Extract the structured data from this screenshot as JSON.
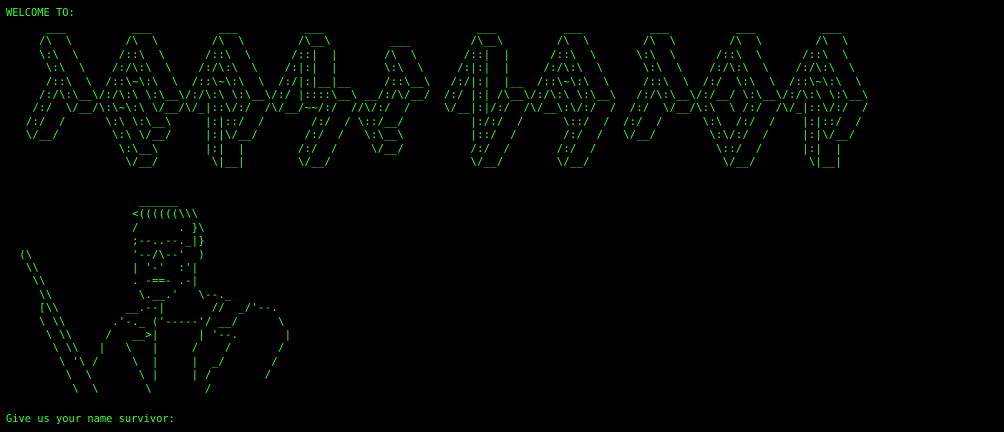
{
  "colors": {
    "background": "#000000",
    "foreground": "#33ff33"
  },
  "terminal": {
    "welcome": "WELCOME TO:",
    "banner_ascii": "      ___          ___          ___          ___                       ___          ___          ___          ___          ___     \n     /\\  \\        /\\  \\        /\\  \\        /\\__\\         ___         /\\__\\        /\\  \\        /\\  \\        /\\  \\        /\\  \\    \n     \\:\\  \\      /::\\  \\      /::\\  \\      /::|  |       /\\  \\       /::|  |      /::\\  \\      \\:\\  \\      /::\\  \\      /::\\  \\   \n      \\:\\  \\    /:/\\:\\  \\    /:/\\:\\  \\    /:|:|  |       \\:\\  \\     /:|:|  |     /:/\\:\\  \\      \\:\\  \\    /:/\\:\\  \\    /:/\\:\\  \\  \n      /::\\  \\  /::\\~\\:\\  \\  /::\\~\\:\\  \\  /:/|:|__|__     /::\\__\\   /:/|:|  |__  /::\\~\\:\\  \\     /::\\  \\  /:/  \\:\\  \\  /::\\~\\:\\  \\ \n     /:/\\:\\__\\/:/\\:\\ \\:\\__\\/:/\\:\\ \\:\\__\\/:/ |::::\\__\\ __/:/\\/__/  /:/ |:| /\\__\\/:/\\:\\ \\:\\__\\   /:/\\:\\__\\/:/__/ \\:\\__\\/:/\\:\\ \\:\\__\\\n    /:/  \\/__/\\:\\~\\:\\ \\/__/\\/_|::\\/:/  /\\/__/~~/:/  //\\/:/  /     \\/__|:|/:/  /\\/__\\:\\/:/  /  /:/  \\/__/\\:\\  \\ /:/  /\\/_|::\\/:/  /\n   /:/  /      \\:\\ \\:\\__\\     |:|::/  /       /:/  / \\::/__/          |:/:/  /      \\::/  /  /:/  /      \\:\\  /:/  /    |:|::/  / \n   \\/__/        \\:\\ \\/__/     |:|\\/__/       /:/  /   \\:\\__\\          |::/  /       /:/  /   \\/__/        \\:\\/:/  /     |:|\\/__/  \n                 \\:\\__\\       |:|  |        /:/  /     \\/__/          /:/  /       /:/  /                  \\::/  /      |:|  |    \n                  \\/__/        \\|__|        \\/__/                     \\/__/        \\/__/                    \\/__/        \\|__|    ",
    "survivor_ascii": "                    ______\n                   <((((((\\\\\\\n                   /      . }\\\n                   ;--..--._|}\n  (\\               '--/\\--'  )\n   \\\\              | '-'  :'|\n    \\\\             . -==- .-|\n     \\\\             \\.__.'   \\--._\n     [\\\\          __.--|       //  _/'--.\n     \\ \\\\       .'-._ ('-----'/ __/      \\\n      \\ \\\\     /   __>|      | '--.       |\n       \\ \\\\   |   \\   |     /    /       /\n        \\ '\\ /     \\  |     |  _/       /\n         \\  \\       \\ |     | /        /\n          \\  \\       \\        /",
    "prompt": "Give us your name survivor:"
  }
}
